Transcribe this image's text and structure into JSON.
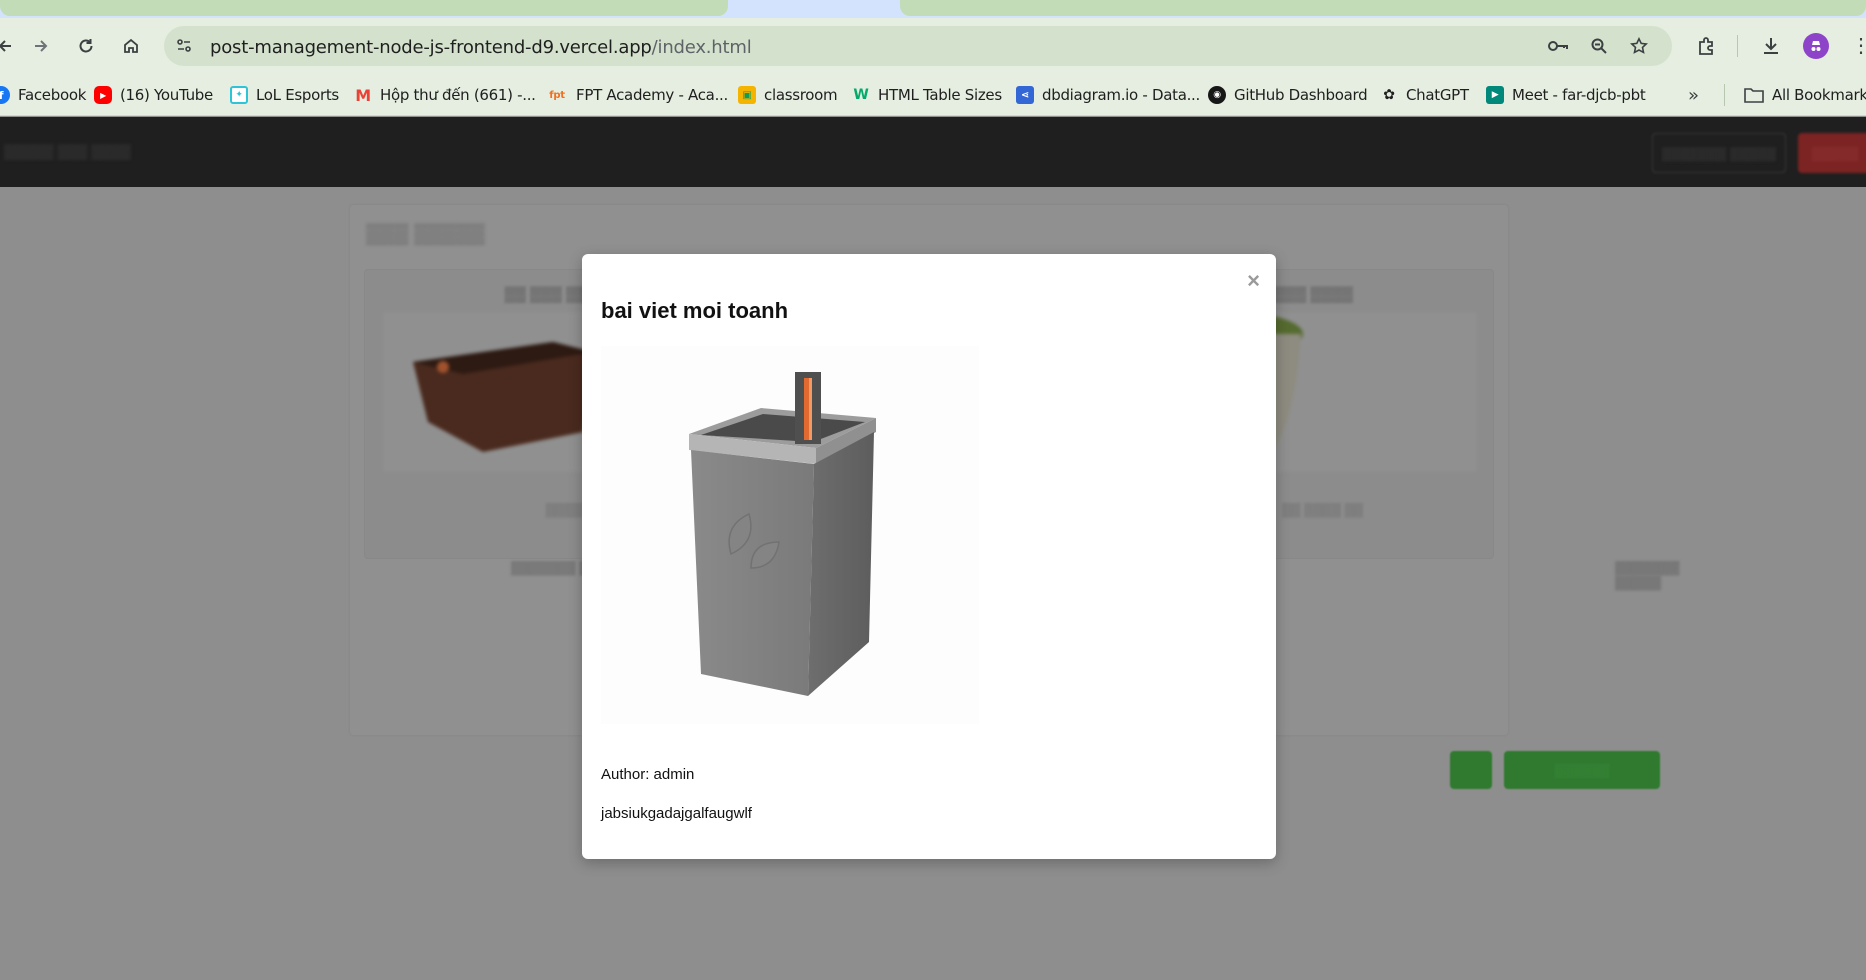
{
  "browser": {
    "url_host": "post-management-node-js-frontend-d9.vercel.app",
    "url_path": "/index.html",
    "bookmarks": [
      {
        "label": "Facebook",
        "icon": "facebook-icon",
        "color": "#1877f2"
      },
      {
        "label": "(16) YouTube",
        "icon": "youtube-icon",
        "color": "#ff0000"
      },
      {
        "label": "LoL Esports",
        "icon": "lol-esports-icon",
        "color": "#2ec4d6"
      },
      {
        "label": "Hộp thư đến (661) -...",
        "icon": "gmail-icon",
        "color": "#ea4335"
      },
      {
        "label": "FPT Academy - Aca...",
        "icon": "fpt-icon",
        "color": "#f26f21"
      },
      {
        "label": "classroom",
        "icon": "classroom-icon",
        "color": "#f4b400"
      },
      {
        "label": "HTML Table Sizes",
        "icon": "w3-icon",
        "color": "#04aa6d"
      },
      {
        "label": "dbdiagram.io - Data...",
        "icon": "dbdiagram-icon",
        "color": "#3367d6"
      },
      {
        "label": "GitHub Dashboard",
        "icon": "github-icon",
        "color": "#181717"
      },
      {
        "label": "ChatGPT",
        "icon": "chatgpt-icon",
        "color": "#1f1f1f"
      },
      {
        "label": "Meet - far-djcb-pbt",
        "icon": "meet-icon",
        "color": "#00897b"
      }
    ],
    "all_bookmarks_label": "All Bookmarks"
  },
  "modal": {
    "title": "bai viet moi toanh",
    "close_glyph": "×",
    "author": "Author: admin",
    "content": "jabsiukgadajgalfaugwlf"
  }
}
